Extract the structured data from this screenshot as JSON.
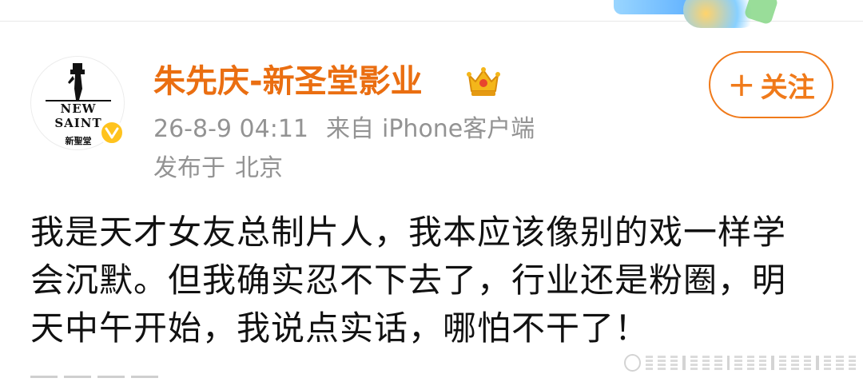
{
  "post": {
    "user_name": "朱先庆-新圣堂影业",
    "avatar_brand": {
      "line1": "NEW",
      "line2": "SAINT",
      "line3": "新聖堂"
    },
    "time": "26-8-9 04:11",
    "source_label": "来自",
    "source": "iPhone客户端",
    "location_label": "发布于",
    "location": "北京",
    "follow_button_label": "关注",
    "follow_button_symbol": "+",
    "text_lines": [
      "我是天才女友总制片人，我本应该像别的戏一样学",
      "会沉默。但我确实忍不下去了，行业还是粉圈，明",
      "天中午开始，我说点实话，哪怕不干了！"
    ]
  },
  "colors": {
    "user_name": "#ea6e11",
    "follow_accent": "#f07a1a",
    "meta_gray": "#939393",
    "body_text": "#111111",
    "verified_badge": "#ffc31e"
  },
  "icons": {
    "crown": "crown-icon",
    "verified": "verified-badge-icon"
  }
}
